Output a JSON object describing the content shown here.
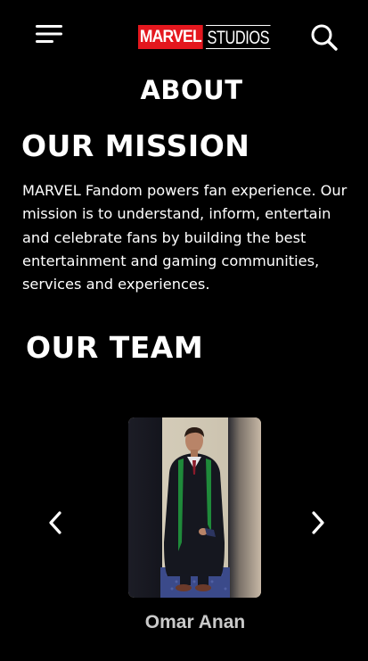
{
  "header": {
    "menu_icon": "hamburger-menu-icon",
    "logo": {
      "marvel": "MARVEL",
      "studios": "STUDIOS",
      "brand_red": "#e4171e"
    },
    "search_icon": "search-icon"
  },
  "page": {
    "title": "ABOUT"
  },
  "mission": {
    "heading": "OUR MISSION",
    "body": "MARVEL Fandom powers fan experience. Our mission is to understand, inform, entertain and celebrate fans by building the best entertainment and gaming communities, services and experiences."
  },
  "team": {
    "heading": "OUR TEAM",
    "prev_icon": "chevron-left-icon",
    "next_icon": "chevron-right-icon",
    "members": [
      {
        "name": "Omar Anan"
      }
    ]
  },
  "colors": {
    "background": "#000000",
    "text": "#ffffff",
    "name_text": "#c9c9c9"
  }
}
